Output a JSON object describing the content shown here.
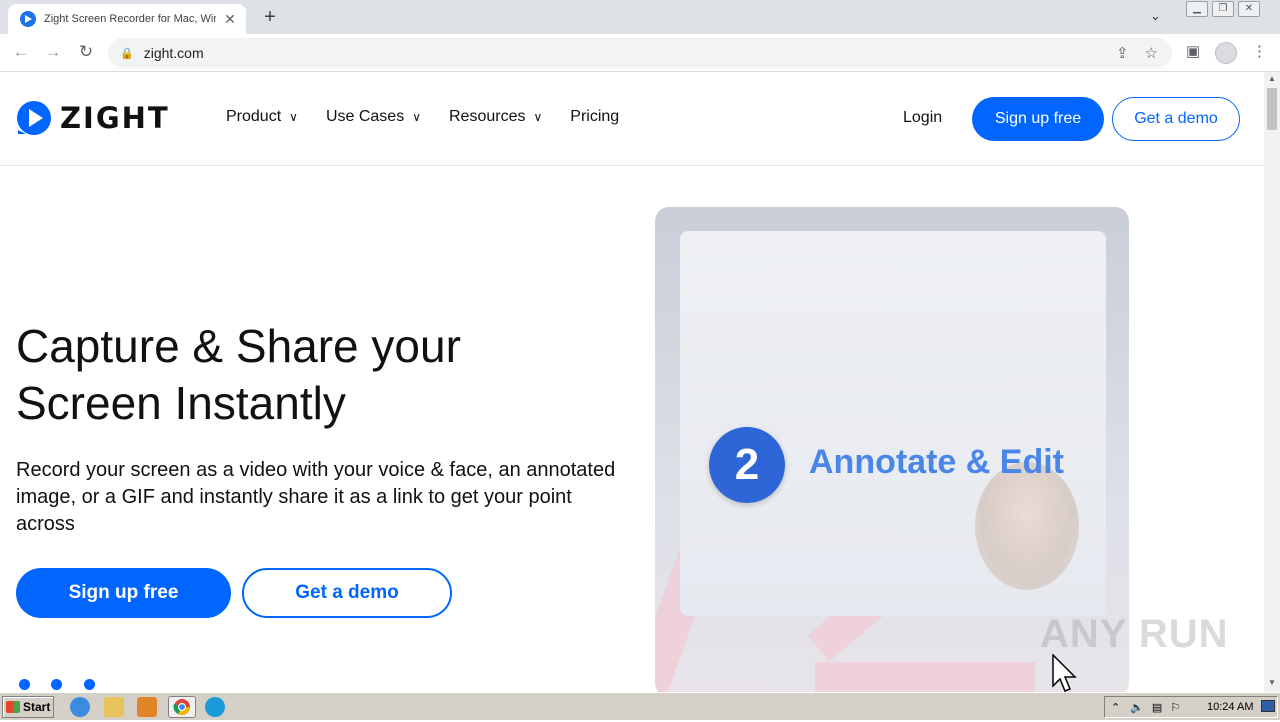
{
  "browser": {
    "tab_title": "Zight Screen Recorder for Mac, Windo",
    "new_tab_icon": "plus-icon",
    "url": "zight.com"
  },
  "header": {
    "brand": "ZIGHT",
    "nav": [
      {
        "label": "Product",
        "has_dropdown": true
      },
      {
        "label": "Use Cases",
        "has_dropdown": true
      },
      {
        "label": "Resources",
        "has_dropdown": true
      },
      {
        "label": "Pricing",
        "has_dropdown": false
      }
    ],
    "login": "Login",
    "signup": "Sign up free",
    "demo": "Get a demo"
  },
  "hero": {
    "title_line1": "Capture & Share your",
    "title_line2": "Screen Instantly",
    "subtitle": "Record your screen as a video with your voice & face, an annotated image, or a GIF and instantly share it as a link to get your point across",
    "signup": "Sign up free",
    "demo": "Get a demo",
    "media_step_number": "2",
    "media_caption": "Annotate & Edit"
  },
  "watermark": "ANY RUN",
  "taskbar": {
    "start": "Start",
    "clock": "10:24 AM"
  },
  "colors": {
    "brand_blue": "#0066ff",
    "caption_blue": "#4a86e8"
  }
}
